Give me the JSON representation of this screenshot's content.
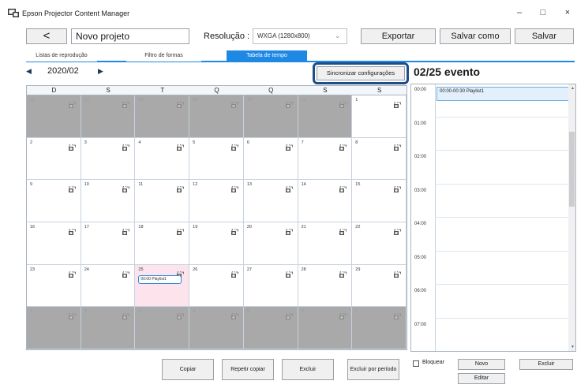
{
  "window": {
    "title": "Epson Projector Content Manager",
    "controls": [
      "–",
      "□",
      "×"
    ]
  },
  "toolbar": {
    "back_label": "<",
    "project_name": "Novo projeto",
    "resolution_label": "Resolução :",
    "resolution_value": "WXGA (1280x800)",
    "export_label": "Exportar",
    "save_as_label": "Salvar como",
    "save_label": "Salvar"
  },
  "tabs": [
    {
      "label": "Listas de reprodução",
      "active": false
    },
    {
      "label": "Filtro de formas",
      "active": false
    },
    {
      "label": "Tabela de tempo",
      "active": true
    }
  ],
  "calendar": {
    "month": "2020/02",
    "sync_label": "Sincronizar configurações",
    "weekdays": [
      "D",
      "S",
      "T",
      "Q",
      "Q",
      "S",
      "S"
    ],
    "weeks": [
      [
        {
          "d": "26",
          "out": true
        },
        {
          "d": "27",
          "out": true
        },
        {
          "d": "28",
          "out": true
        },
        {
          "d": "29",
          "out": true
        },
        {
          "d": "30",
          "out": true
        },
        {
          "d": "31",
          "out": true
        },
        {
          "d": "1",
          "out": false
        }
      ],
      [
        {
          "d": "2",
          "out": false
        },
        {
          "d": "3",
          "out": false
        },
        {
          "d": "4",
          "out": false
        },
        {
          "d": "5",
          "out": false
        },
        {
          "d": "6",
          "out": false
        },
        {
          "d": "7",
          "out": false
        },
        {
          "d": "8",
          "out": false
        }
      ],
      [
        {
          "d": "9",
          "out": false
        },
        {
          "d": "10",
          "out": false
        },
        {
          "d": "11",
          "out": false
        },
        {
          "d": "12",
          "out": false
        },
        {
          "d": "13",
          "out": false
        },
        {
          "d": "14",
          "out": false
        },
        {
          "d": "15",
          "out": false
        }
      ],
      [
        {
          "d": "16",
          "out": false
        },
        {
          "d": "17",
          "out": false
        },
        {
          "d": "18",
          "out": false
        },
        {
          "d": "19",
          "out": false
        },
        {
          "d": "20",
          "out": false
        },
        {
          "d": "21",
          "out": false
        },
        {
          "d": "22",
          "out": false
        }
      ],
      [
        {
          "d": "23",
          "out": false
        },
        {
          "d": "24",
          "out": false
        },
        {
          "d": "25",
          "out": false,
          "selected": true,
          "event": "00:00 Playlist1"
        },
        {
          "d": "26",
          "out": false
        },
        {
          "d": "27",
          "out": false
        },
        {
          "d": "28",
          "out": false
        },
        {
          "d": "29",
          "out": false
        }
      ],
      [
        {
          "d": "1",
          "out": true
        },
        {
          "d": "2",
          "out": true
        },
        {
          "d": "3",
          "out": true
        },
        {
          "d": "4",
          "out": true
        },
        {
          "d": "5",
          "out": true
        },
        {
          "d": "6",
          "out": true
        },
        {
          "d": "7",
          "out": true
        }
      ]
    ]
  },
  "bottom_buttons": {
    "copy": "Copiar",
    "repeat_copy": "Repetir copiar",
    "delete": "Excluir",
    "delete_period": "Excluir por período"
  },
  "schedule": {
    "title": "02/25 evento",
    "hours": [
      "00:00",
      "01:00",
      "02:00",
      "03:00",
      "04:00",
      "05:00",
      "06:00",
      "07:00"
    ],
    "event": "00:00-00:30 Playlist1",
    "lock_label": "Bloquear",
    "new_label": "Novo",
    "delete_label": "Excluir",
    "edit_label": "Editar"
  },
  "colors": {
    "accent": "#1e88e5",
    "highlight": "#1c4e8a",
    "out_of_month": "#a9a9a9",
    "selected_day": "#fde4ec"
  }
}
